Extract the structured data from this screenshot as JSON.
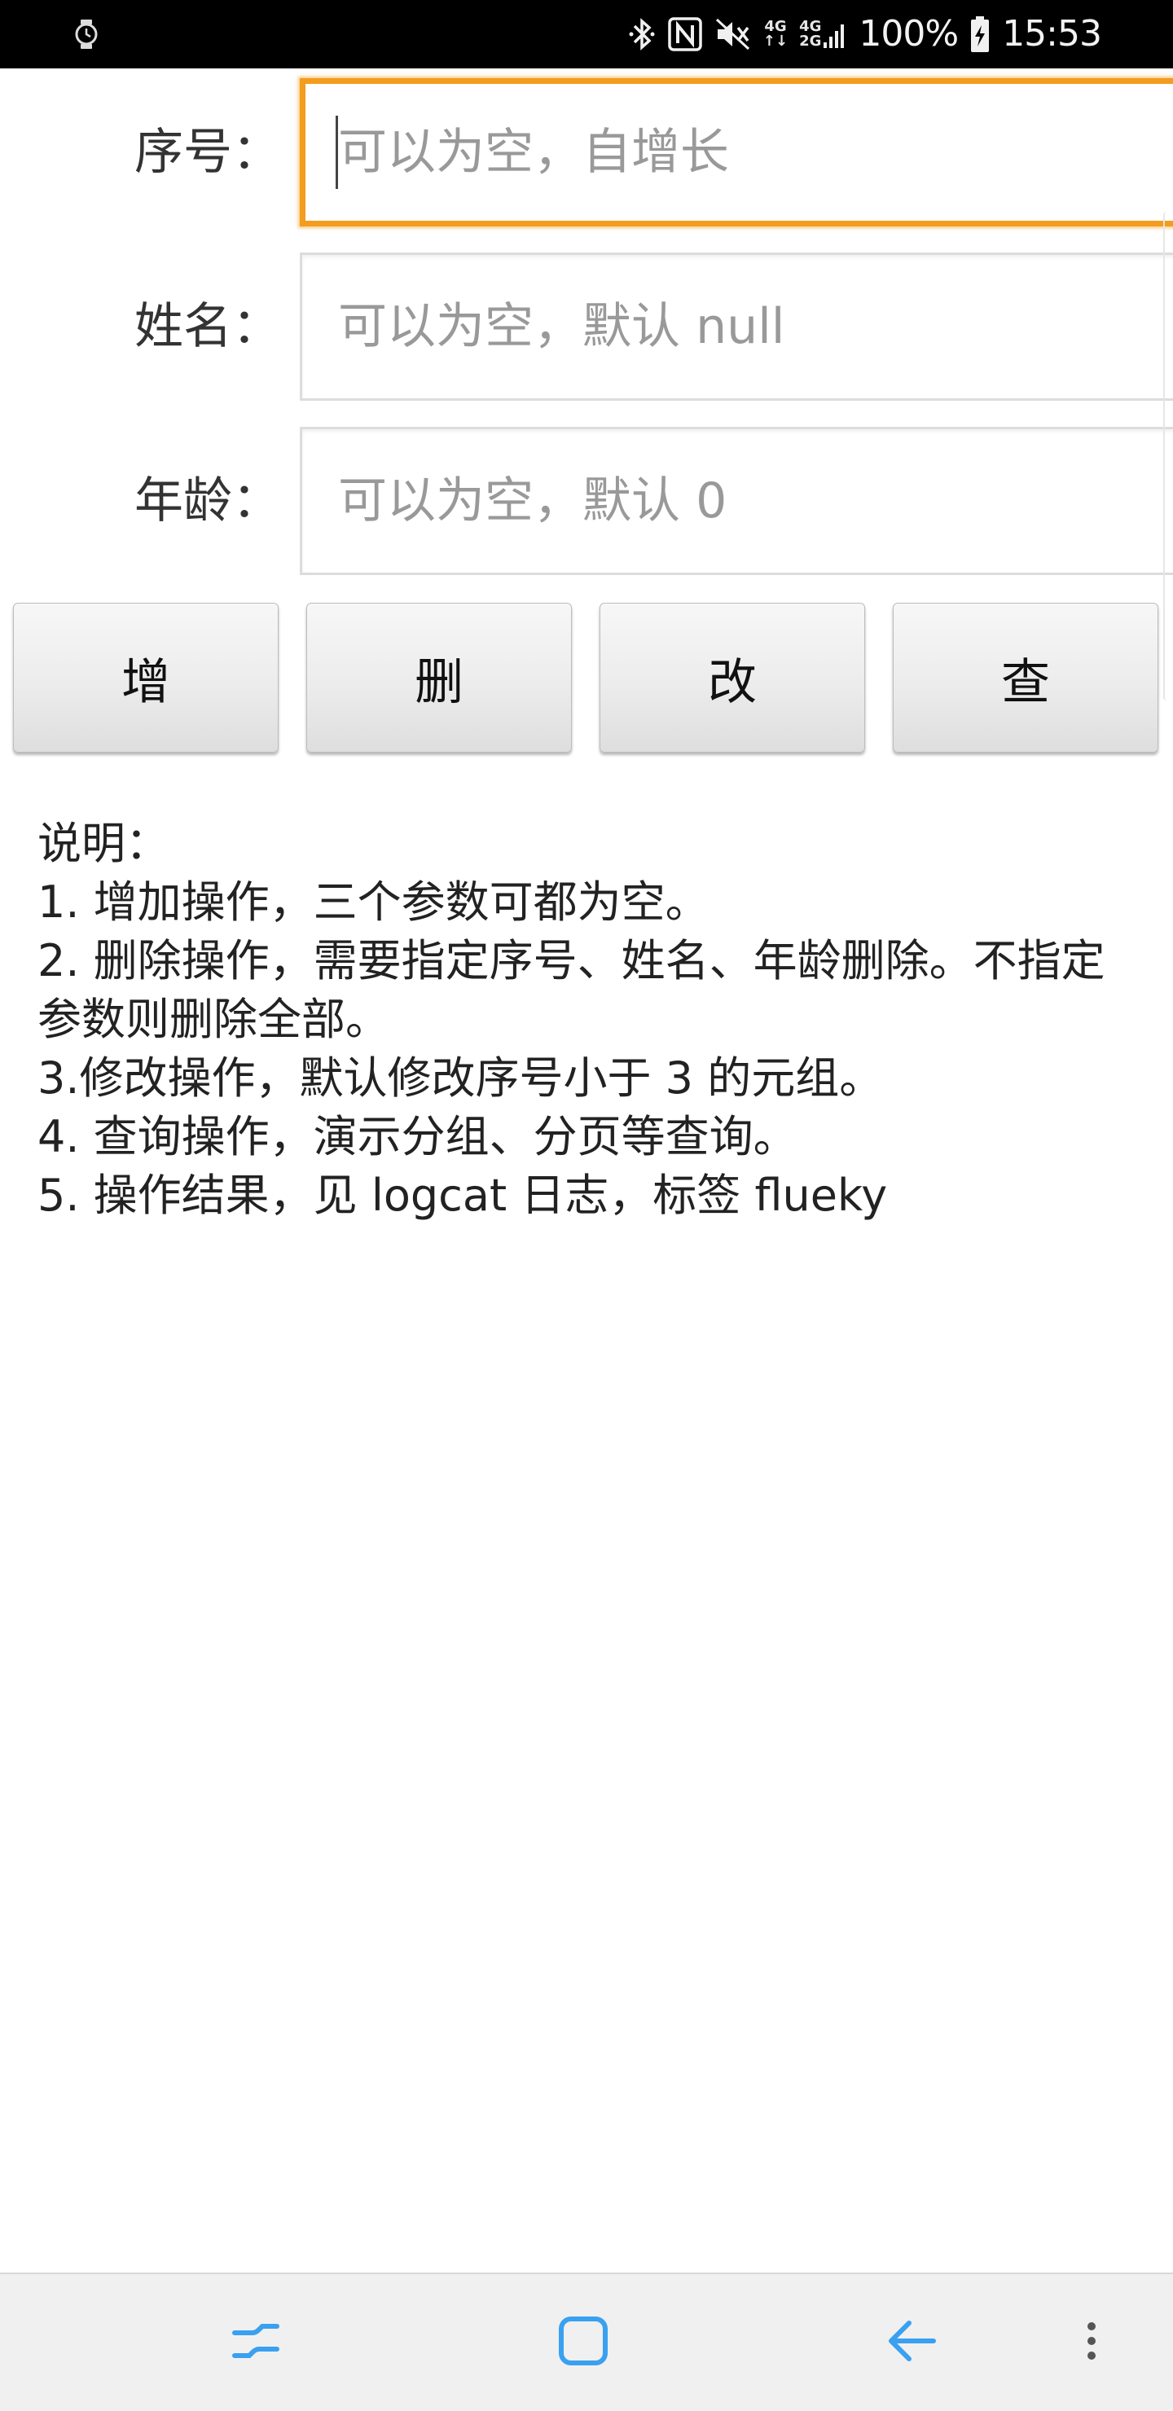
{
  "status_bar": {
    "left_icon": "watch-icon",
    "icons": [
      "bluetooth-icon",
      "nfc-icon",
      "mute-icon",
      "signal-4g-icon",
      "signal-4g-2g-icon",
      "battery-charging-icon"
    ],
    "net_a": [
      "4G",
      "↑↓"
    ],
    "net_b": [
      "4G",
      "2G"
    ],
    "battery": "100%",
    "time": "15:53"
  },
  "form": {
    "seq": {
      "label": "序号：",
      "placeholder": "可以为空，自增长"
    },
    "name": {
      "label": "姓名：",
      "placeholder": "可以为空，默认 null"
    },
    "age": {
      "label": "年龄：",
      "placeholder": "可以为空，默认 0"
    }
  },
  "buttons": {
    "add": "增",
    "delete": "删",
    "update": "改",
    "query": "查"
  },
  "description": {
    "title": "说明：",
    "lines": [
      "1. 增加操作，三个参数可都为空。",
      "2. 删除操作，需要指定序号、姓名、年龄删除。不指定参数则删除全部。",
      "3.修改操作，默认修改序号小于 3 的元组。",
      "4. 查询操作，演示分组、分页等查询。",
      "5. 操作结果，见 logcat 日志，标签 flueky"
    ]
  },
  "nav_bar": {
    "recent": "recent-apps-icon",
    "home": "home-icon",
    "back": "back-icon",
    "more": "more-vert-icon",
    "icon_color": "#3aa0f0"
  },
  "colors": {
    "focus_border": "#f39c1e",
    "status_bar_bg": "#000000",
    "nav_bar_bg": "#f0f0f0"
  }
}
